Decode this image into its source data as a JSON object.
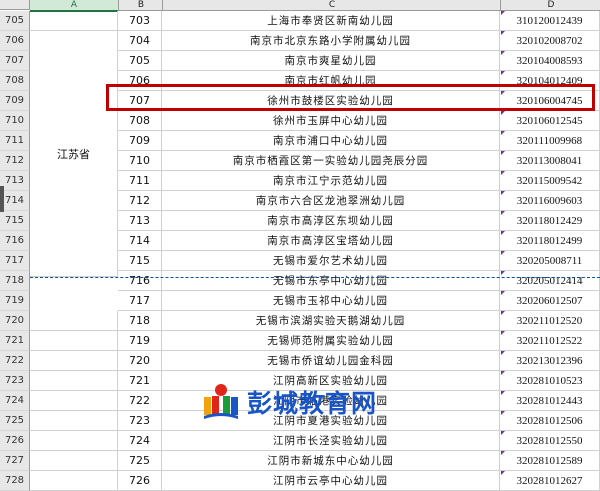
{
  "columns": {
    "a": "A",
    "b": "B",
    "c": "C",
    "d": "D"
  },
  "province": "江苏省",
  "rows": [
    {
      "row": "705",
      "b": "703",
      "c": "上海市奉贤区新南幼儿园",
      "d": "310120012439"
    },
    {
      "row": "706",
      "b": "704",
      "c": "南京市北京东路小学附属幼儿园",
      "d": "320102008702"
    },
    {
      "row": "707",
      "b": "705",
      "c": "南京市爽星幼儿园",
      "d": "320104008593"
    },
    {
      "row": "708",
      "b": "706",
      "c": "南京市红帆幼儿园",
      "d": "320104012409"
    },
    {
      "row": "709",
      "b": "707",
      "c": "徐州市鼓楼区实验幼儿园",
      "d": "320106004745"
    },
    {
      "row": "710",
      "b": "708",
      "c": "徐州市玉屏中心幼儿园",
      "d": "320106012545"
    },
    {
      "row": "711",
      "b": "709",
      "c": "南京市浦口中心幼儿园",
      "d": "320111009968"
    },
    {
      "row": "712",
      "b": "710",
      "c": "南京市栖霞区第一实验幼儿园尧辰分园",
      "d": "320113008041"
    },
    {
      "row": "713",
      "b": "711",
      "c": "南京市江宁示范幼儿园",
      "d": "320115009542"
    },
    {
      "row": "714",
      "b": "712",
      "c": "南京市六合区龙池翠洲幼儿园",
      "d": "320116009603"
    },
    {
      "row": "715",
      "b": "713",
      "c": "南京市高淳区东坝幼儿园",
      "d": "320118012429"
    },
    {
      "row": "716",
      "b": "714",
      "c": "南京市高淳区宝塔幼儿园",
      "d": "320118012499"
    },
    {
      "row": "717",
      "b": "715",
      "c": "无锡市爱尔艺术幼儿园",
      "d": "320205008711"
    },
    {
      "row": "718",
      "b": "716",
      "c": "无锡市东亭中心幼儿园",
      "d": "320205012414"
    },
    {
      "row": "719",
      "b": "717",
      "c": "无锡市玉祁中心幼儿园",
      "d": "320206012507"
    },
    {
      "row": "720",
      "b": "718",
      "c": "无锡市滨湖实验天鹅湖幼儿园",
      "d": "320211012520"
    },
    {
      "row": "721",
      "b": "719",
      "c": "无锡师范附属实验幼儿园",
      "d": "320211012522"
    },
    {
      "row": "722",
      "b": "720",
      "c": "无锡市侨谊幼儿园金科园",
      "d": "320213012396"
    },
    {
      "row": "723",
      "b": "721",
      "c": "江阴高新区实验幼儿园",
      "d": "320281010523"
    },
    {
      "row": "724",
      "b": "722",
      "c": "江阴市临港实验幼儿园",
      "d": "320281012443"
    },
    {
      "row": "725",
      "b": "723",
      "c": "江阴市夏港实验幼儿园",
      "d": "320281012506"
    },
    {
      "row": "726",
      "b": "724",
      "c": "江阴市长泾实验幼儿园",
      "d": "320281012550"
    },
    {
      "row": "727",
      "b": "725",
      "c": "江阴市新城东中心幼儿园",
      "d": "320281012589"
    },
    {
      "row": "728",
      "b": "726",
      "c": "江阴市云亭中心幼儿园",
      "d": "320281012627"
    }
  ],
  "watermark": "彭城教育网"
}
